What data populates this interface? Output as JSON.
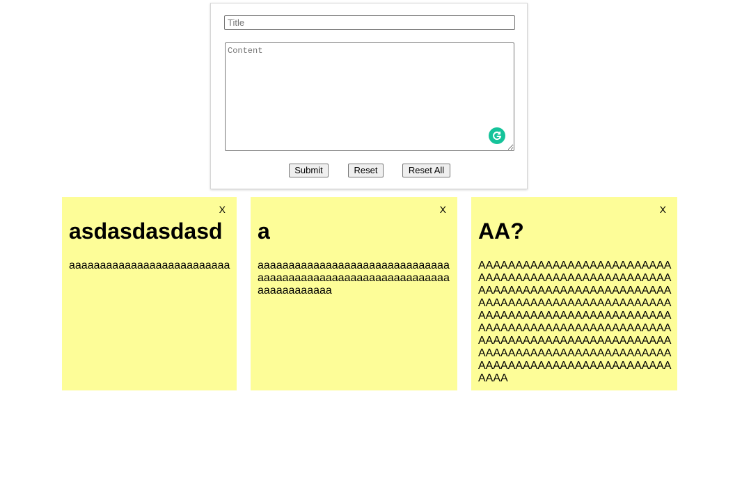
{
  "form": {
    "title_placeholder": "Title",
    "content_placeholder": "Content",
    "submit_label": "Submit",
    "reset_label": "Reset",
    "reset_all_label": "Reset All",
    "grammarly_icon": "grammarly-icon",
    "grammarly_color": "#15c39a"
  },
  "note_color": "#fdfd98",
  "notes": [
    {
      "close_label": "X",
      "title": "asdasdasdasd",
      "content": "aaaaaaaaaaaaaaaaaaaaaaaaaa"
    },
    {
      "close_label": "X",
      "title": "a",
      "content": "aaaaaaaaaaaaaaaaaaaaaaaaaaaaaaaaaaaaaaaaaaaaaaaaaaaaaaaaaaaaaaaaaaaaaaaaaa"
    },
    {
      "close_label": "X",
      "title": "AA?",
      "content": "AAAAAAAAAAAAAAAAAAAAAAAAAAAAAAAAAAAAAAAAAAAAAAAAAAAAAAAAAAAAAAAAAAAAAAAAAAAAAAAAAAAAAAAAAAAAAAAAAAAAAAAAAAAAAAAAAAAAAAAAAAAAAAAAAAAAAAAAAAAAAAAAAAAAAAAAAAAAAAAAAAAAAAAAAAAAAAAAAAAAAAAAAAAAAAAAAAAAAAAAAAAAAAAAAAAAAAAAAAAAAAAAAAAAAAAAAAAAAA"
    }
  ]
}
